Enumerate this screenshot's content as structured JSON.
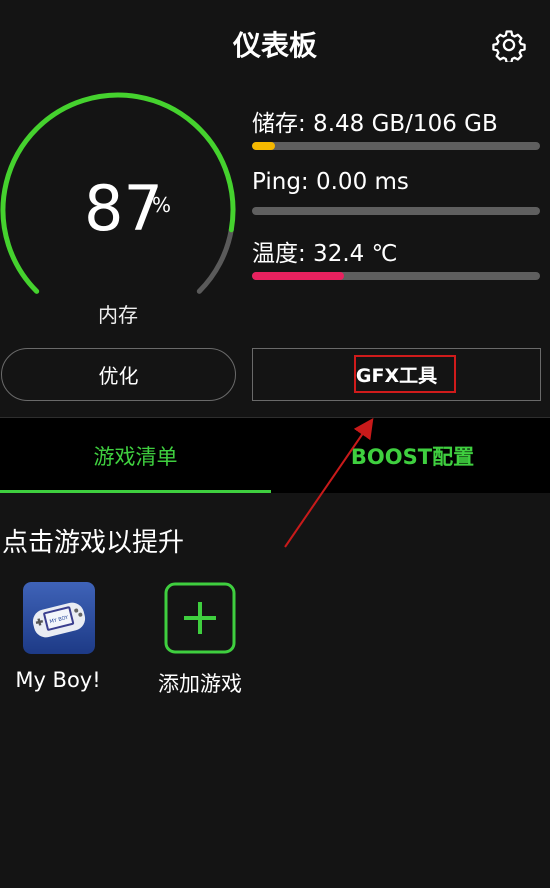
{
  "header": {
    "title": "仪表板",
    "settings_icon": "gear-icon"
  },
  "gauge": {
    "value": "87",
    "unit": "%",
    "label": "内存",
    "percent": 87,
    "color": "#45d22e"
  },
  "stats": {
    "storage": {
      "text": "储存: 8.48 GB/106 GB",
      "fill": 0.08,
      "color": "#f5b800"
    },
    "ping": {
      "text": "Ping: 0.00 ms",
      "fill": 0.0,
      "color": "#3fcf3f"
    },
    "temp": {
      "text": "温度: 32.4 ℃",
      "fill": 0.32,
      "color": "#e8215f"
    }
  },
  "buttons": {
    "optimize": "优化",
    "gfx": "GFX工具"
  },
  "tabs": {
    "game_list": "游戏清单",
    "boost_config": "BOOST配置"
  },
  "section_title": "点击游戏以提升",
  "games": [
    {
      "label": "My Boy!",
      "icon": "my-boy-app-icon"
    },
    {
      "label": "添加游戏",
      "icon": "add-game-icon"
    }
  ],
  "colors": {
    "accent": "#3fcf3f",
    "background": "#141414",
    "annotation": "#d01b1b"
  }
}
